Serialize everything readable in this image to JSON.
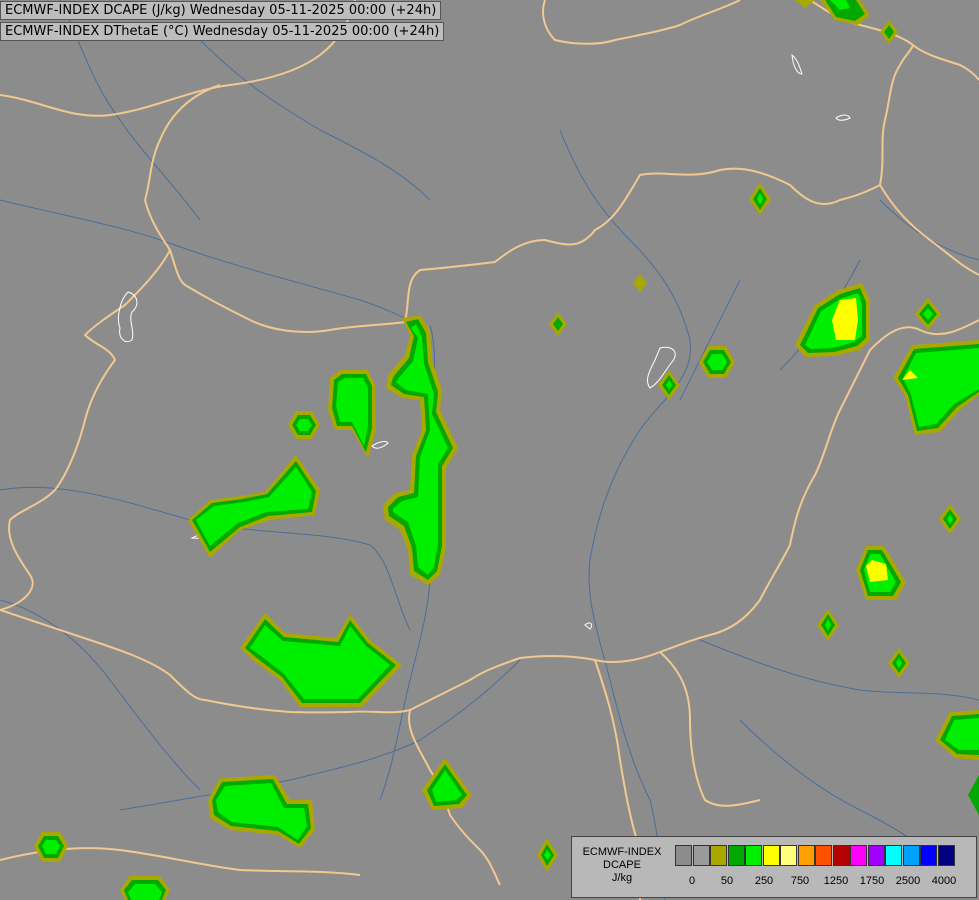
{
  "titles": {
    "line1": "ECMWF-INDEX DCAPE (J/kg) Wednesday 05-11-2025 00:00 (+24h)",
    "line2": "ECMWF-INDEX DThetaE (°C) Wednesday 05-11-2025 00:00 (+24h)"
  },
  "colors": {
    "background": "#8c8c8c",
    "border": "#f0c890",
    "rivers": "#4a6e9a",
    "lakes": "#ffffff",
    "band_50": "#a8a800",
    "band_250": "#00a800",
    "band_500": "#00ee00",
    "band_750": "#ffff00"
  },
  "legend": {
    "title_lines": [
      "ECMWF-INDEX",
      "DCAPE",
      "J/kg"
    ],
    "swatches": [
      "#8c8c8c",
      "#9a9a9a",
      "#a8a800",
      "#00a800",
      "#00ee00",
      "#ffff00",
      "#ffff80",
      "#ffa000",
      "#ff5000",
      "#b40000",
      "#ff00ff",
      "#a000ff",
      "#00ffff",
      "#00a0ff",
      "#0000ff",
      "#000080"
    ],
    "ticks": [
      "0",
      "50",
      "250",
      "750",
      "1250",
      "1750",
      "2500",
      "4000"
    ]
  }
}
